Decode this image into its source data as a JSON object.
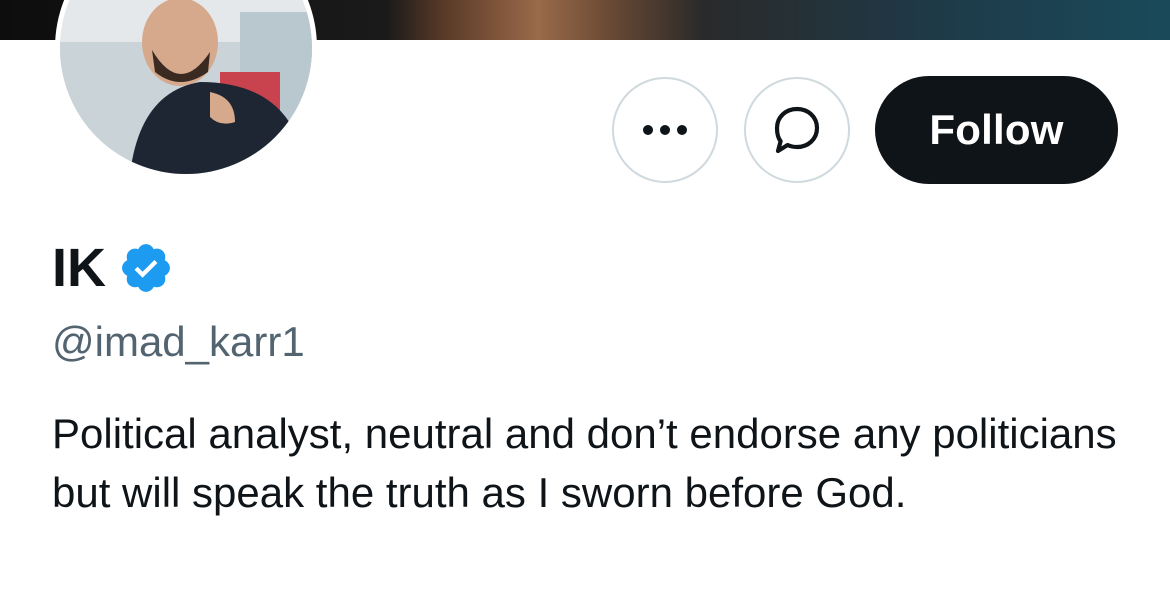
{
  "profile": {
    "display_name": "IK",
    "handle": "@imad_karr1",
    "bio": "Political analyst, neutral and don’t endorse any politicians but will speak the truth as I sworn before God.",
    "verified": true
  },
  "actions": {
    "more_icon": "ellipsis-icon",
    "message_icon": "message-bubble-icon",
    "follow_label": "Follow"
  },
  "colors": {
    "verified_badge": "#1d9bf0",
    "follow_bg": "#0f1419",
    "handle_text": "#536471"
  }
}
